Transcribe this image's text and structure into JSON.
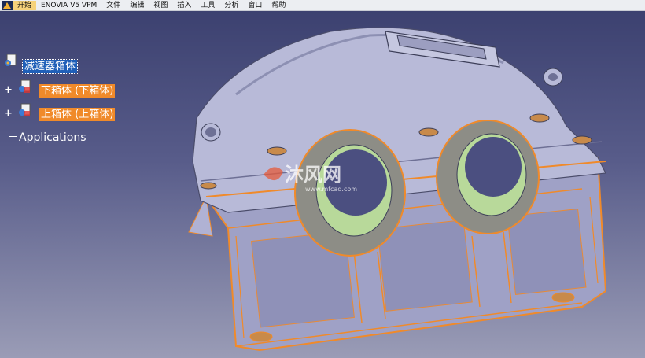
{
  "menubar": {
    "items": [
      "开始",
      "ENOVIA V5 VPM",
      "文件",
      "编辑",
      "视图",
      "插入",
      "工具",
      "分析",
      "窗口",
      "帮助"
    ]
  },
  "tree": {
    "root_label": "减速器箱体",
    "children": [
      {
        "label": "下箱体 (下箱体)"
      },
      {
        "label": "上箱体 (上箱体)"
      }
    ],
    "applications_label": "Applications"
  },
  "watermark": {
    "text": "沐风网",
    "url": "www.mfcad.com"
  },
  "colors": {
    "background_top": "#3a3f6e",
    "background_bottom": "#9a9cb6",
    "highlight_orange": "#f08a2a",
    "selection_blue": "#1f5fb8",
    "model_body": "#b8bad8",
    "bearing_ring": "#8d8d86"
  }
}
